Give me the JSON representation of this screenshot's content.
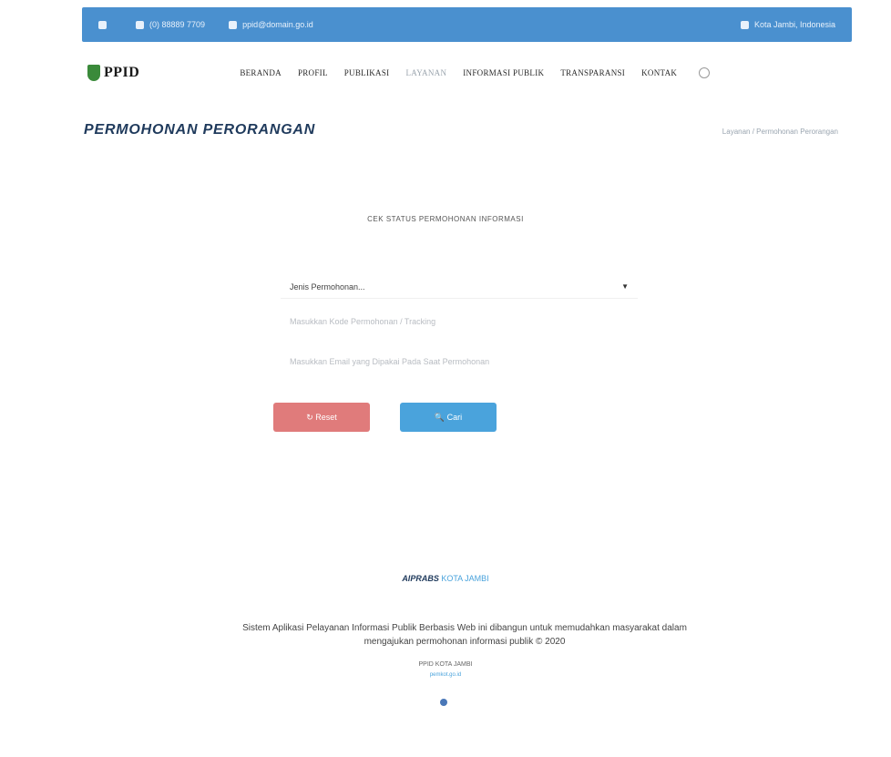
{
  "topbar": {
    "phone": "(0) 88889 7709",
    "email": "ppid@domain.go.id",
    "right_text": "Kota Jambi, Indonesia"
  },
  "header": {
    "logo_text": "PPID",
    "nav": [
      "BERANDA",
      "PROFIL",
      "PUBLIKASI",
      "LAYANAN",
      "INFORMASI PUBLIK",
      "TRANSPARANSI",
      "KONTAK"
    ],
    "active_index": 3
  },
  "page": {
    "title": "PERMOHONAN PERORANGAN",
    "breadcrumb": "Layanan / Permohonan Perorangan"
  },
  "form": {
    "heading": "CEK STATUS PERMOHONAN INFORMASI",
    "select_value": "Jenis Permohonan...",
    "field1_placeholder": "Masukkan Kode Permohonan / Tracking",
    "field2_placeholder": "Masukkan Email yang Dipakai Pada Saat Permohonan",
    "reset_label": "↻ Reset",
    "find_label": "🔍 Cari"
  },
  "footer": {
    "brand_bold": "AIPRABS",
    "brand_rest": "KOTA JAMBI",
    "description": "Sistem Aplikasi Pelayanan Informasi Publik Berbasis Web ini dibangun untuk memudahkan masyarakat dalam mengajukan permohonan informasi publik © 2020",
    "contact": "PPID KOTA JAMBI",
    "small_link": "pemkot.go.id"
  },
  "colors": {
    "topbar": "#4a90cf",
    "title": "#1f3a5c",
    "reset_button": "#e07b7b",
    "find_button": "#4aa3dc"
  }
}
